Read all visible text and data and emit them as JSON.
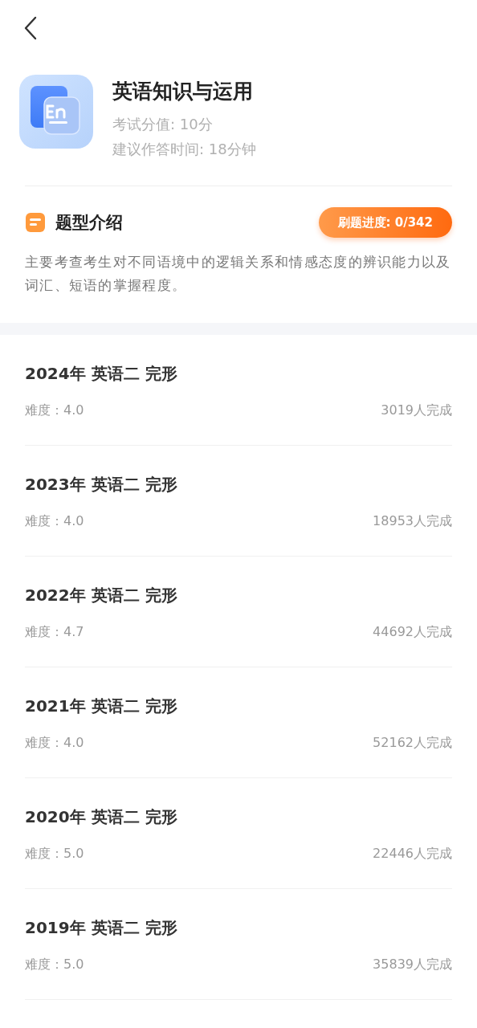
{
  "header": {
    "title": "英语知识与运用",
    "score": "考试分值: 10分",
    "time": "建议作答时间: 18分钟"
  },
  "intro": {
    "heading": "题型介绍",
    "progress": "刷题进度: 0/342",
    "description": "主要考查考生对不同语境中的逻辑关系和情感态度的辨识能力以及词汇、短语的掌握程度。"
  },
  "papers": [
    {
      "title": "2024年 英语二 完形",
      "difficulty": "难度：4.0",
      "completed": "3019人完成"
    },
    {
      "title": "2023年 英语二 完形",
      "difficulty": "难度：4.0",
      "completed": "18953人完成"
    },
    {
      "title": "2022年 英语二 完形",
      "difficulty": "难度：4.7",
      "completed": "44692人完成"
    },
    {
      "title": "2021年 英语二 完形",
      "difficulty": "难度：4.0",
      "completed": "52162人完成"
    },
    {
      "title": "2020年 英语二 完形",
      "difficulty": "难度：5.0",
      "completed": "22446人完成"
    },
    {
      "title": "2019年 英语二 完形",
      "difficulty": "难度：5.0",
      "completed": "35839人完成"
    }
  ]
}
